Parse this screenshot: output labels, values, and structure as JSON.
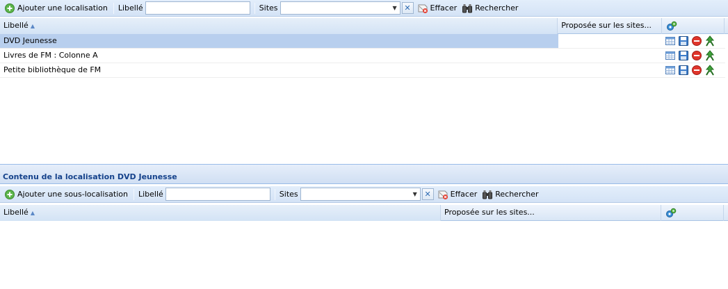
{
  "top": {
    "toolbar": {
      "add_label": "Ajouter une localisation",
      "libelle_label": "Libellé",
      "libelle_value": "",
      "sites_label": "Sites",
      "sites_value": "",
      "clear_label": "Effacer",
      "search_label": "Rechercher"
    },
    "grid": {
      "col_libelle": "Libellé",
      "col_sites": "Proposée sur les sites...",
      "rows": [
        {
          "libelle": "DVD Jeunesse",
          "sites": ""
        },
        {
          "libelle": "Livres de FM : Colonne A",
          "sites": ""
        },
        {
          "libelle": "Petite bibliothèque de FM",
          "sites": ""
        }
      ]
    }
  },
  "bottom": {
    "title": "Contenu de la localisation DVD Jeunesse",
    "toolbar": {
      "add_label": "Ajouter une sous-localisation",
      "libelle_label": "Libellé",
      "libelle_value": "",
      "sites_label": "Sites",
      "sites_value": "",
      "clear_label": "Effacer",
      "search_label": "Rechercher"
    },
    "grid": {
      "col_libelle": "Libellé",
      "col_sites": "Proposée sur les sites..."
    }
  },
  "icons": {
    "add": "add-circle-icon",
    "clear": "eraser-icon",
    "search": "binoculars-icon",
    "columns": "gears-icon",
    "row_actions": [
      "table-icon",
      "save-icon",
      "delete-icon",
      "move-up-icon"
    ]
  },
  "colors": {
    "toolbar_bg": "#d4e3f6",
    "selected_row": "#b8cfee",
    "title_text": "#15428b"
  }
}
